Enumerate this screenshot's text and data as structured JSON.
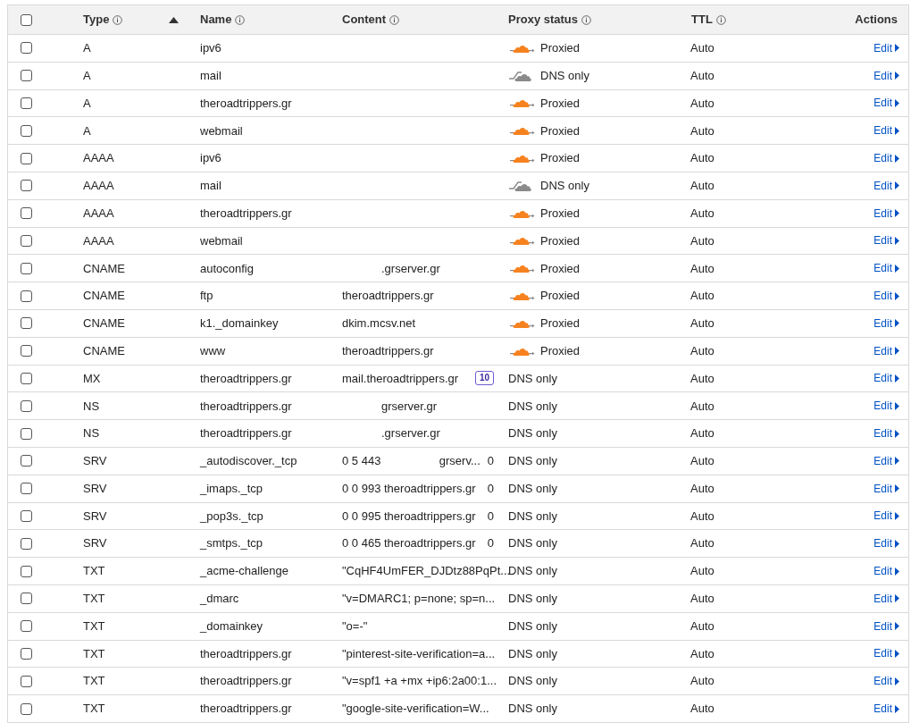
{
  "header": {
    "checkbox": {
      "checked": false
    },
    "columns": [
      {
        "label": "Type",
        "info": true,
        "sorted": true
      },
      {
        "label": "Name",
        "info": true
      },
      {
        "label": "Content",
        "info": true
      },
      {
        "label": "Proxy status",
        "info": true
      },
      {
        "label": "TTL",
        "info": true
      },
      {
        "label": "Actions",
        "info": false
      }
    ]
  },
  "rows": [
    {
      "checked": false,
      "type": "A",
      "name": "ipv6",
      "proxy": {
        "kind": "proxied",
        "label": "Proxied"
      },
      "ttl": "Auto",
      "action": "Edit"
    },
    {
      "checked": false,
      "type": "A",
      "name": "mail",
      "proxy": {
        "kind": "dns_only",
        "label": "DNS only"
      },
      "ttl": "Auto",
      "action": "Edit"
    },
    {
      "checked": false,
      "type": "A",
      "name": "theroadtrippers.gr",
      "proxy": {
        "kind": "proxied",
        "label": "Proxied"
      },
      "ttl": "Auto",
      "action": "Edit"
    },
    {
      "checked": false,
      "type": "A",
      "name": "webmail",
      "proxy": {
        "kind": "proxied",
        "label": "Proxied"
      },
      "ttl": "Auto",
      "action": "Edit"
    },
    {
      "checked": false,
      "type": "AAAA",
      "name": "ipv6",
      "proxy": {
        "kind": "proxied",
        "label": "Proxied"
      },
      "ttl": "Auto",
      "action": "Edit"
    },
    {
      "checked": false,
      "type": "AAAA",
      "name": "mail",
      "proxy": {
        "kind": "dns_only",
        "label": "DNS only"
      },
      "ttl": "Auto",
      "action": "Edit"
    },
    {
      "checked": false,
      "type": "AAAA",
      "name": "theroadtrippers.gr",
      "proxy": {
        "kind": "proxied",
        "label": "Proxied"
      },
      "ttl": "Auto",
      "action": "Edit"
    },
    {
      "checked": false,
      "type": "AAAA",
      "name": "webmail",
      "proxy": {
        "kind": "proxied",
        "label": "Proxied"
      },
      "ttl": "Auto",
      "action": "Edit"
    },
    {
      "checked": false,
      "type": "CNAME",
      "name": "autoconfig",
      "content": {
        "redacted": true,
        "text": ".grserver.gr"
      },
      "proxy": {
        "kind": "proxied",
        "label": "Proxied"
      },
      "ttl": "Auto",
      "action": "Edit"
    },
    {
      "checked": false,
      "type": "CNAME",
      "name": "ftp",
      "content": {
        "text": "theroadtrippers.gr"
      },
      "proxy": {
        "kind": "proxied",
        "label": "Proxied"
      },
      "ttl": "Auto",
      "action": "Edit"
    },
    {
      "checked": false,
      "type": "CNAME",
      "name": "k1._domainkey",
      "content": {
        "text": "dkim.mcsv.net"
      },
      "proxy": {
        "kind": "proxied",
        "label": "Proxied"
      },
      "ttl": "Auto",
      "action": "Edit"
    },
    {
      "checked": false,
      "type": "CNAME",
      "name": "www",
      "content": {
        "text": "theroadtrippers.gr"
      },
      "proxy": {
        "kind": "proxied",
        "label": "Proxied"
      },
      "ttl": "Auto",
      "action": "Edit"
    },
    {
      "checked": false,
      "type": "MX",
      "name": "theroadtrippers.gr",
      "content": {
        "text": "mail.theroadtrippers.gr",
        "badge": "10"
      },
      "proxy": {
        "kind": "none",
        "label": "DNS only"
      },
      "ttl": "Auto",
      "action": "Edit"
    },
    {
      "checked": false,
      "type": "NS",
      "name": "theroadtrippers.gr",
      "content": {
        "redacted": true,
        "text": "grserver.gr"
      },
      "proxy": {
        "kind": "none",
        "label": "DNS only"
      },
      "ttl": "Auto",
      "action": "Edit"
    },
    {
      "checked": false,
      "type": "NS",
      "name": "theroadtrippers.gr",
      "content": {
        "redacted": true,
        "text": ".grserver.gr"
      },
      "proxy": {
        "kind": "none",
        "label": "DNS only"
      },
      "ttl": "Auto",
      "action": "Edit"
    },
    {
      "checked": false,
      "type": "SRV",
      "name": "_autodiscover._tcp",
      "content": {
        "text": "0 5 443",
        "text_2": "grserv...",
        "trailing": "0"
      },
      "proxy": {
        "kind": "none",
        "label": "DNS only"
      },
      "ttl": "Auto",
      "action": "Edit"
    },
    {
      "checked": false,
      "type": "SRV",
      "name": "_imaps._tcp",
      "content": {
        "text": "0 0 993 theroadtrippers.gr",
        "trailing": "0"
      },
      "proxy": {
        "kind": "none",
        "label": "DNS only"
      },
      "ttl": "Auto",
      "action": "Edit"
    },
    {
      "checked": false,
      "type": "SRV",
      "name": "_pop3s._tcp",
      "content": {
        "text": "0 0 995 theroadtrippers.gr",
        "trailing": "0"
      },
      "proxy": {
        "kind": "none",
        "label": "DNS only"
      },
      "ttl": "Auto",
      "action": "Edit"
    },
    {
      "checked": false,
      "type": "SRV",
      "name": "_smtps._tcp",
      "content": {
        "text": "0 0 465 theroadtrippers.gr",
        "trailing": "0"
      },
      "proxy": {
        "kind": "none",
        "label": "DNS only"
      },
      "ttl": "Auto",
      "action": "Edit"
    },
    {
      "checked": false,
      "type": "TXT",
      "name": "_acme-challenge",
      "content": {
        "text": "\"CqHF4UmFER_DJDtz88PqPt..."
      },
      "proxy": {
        "kind": "none",
        "label": "DNS only"
      },
      "ttl": "Auto",
      "action": "Edit"
    },
    {
      "checked": false,
      "type": "TXT",
      "name": "_dmarc",
      "content": {
        "text": "\"v=DMARC1; p=none; sp=n..."
      },
      "proxy": {
        "kind": "none",
        "label": "DNS only"
      },
      "ttl": "Auto",
      "action": "Edit"
    },
    {
      "checked": false,
      "type": "TXT",
      "name": "_domainkey",
      "content": {
        "text": "\"o=-\""
      },
      "proxy": {
        "kind": "none",
        "label": "DNS only"
      },
      "ttl": "Auto",
      "action": "Edit"
    },
    {
      "checked": false,
      "type": "TXT",
      "name": "theroadtrippers.gr",
      "content": {
        "text": "\"pinterest-site-verification=a..."
      },
      "proxy": {
        "kind": "none",
        "label": "DNS only"
      },
      "ttl": "Auto",
      "action": "Edit"
    },
    {
      "checked": false,
      "type": "TXT",
      "name": "theroadtrippers.gr",
      "content": {
        "text": "\"v=spf1 +a +mx +ip6:2a00:1..."
      },
      "proxy": {
        "kind": "none",
        "label": "DNS only"
      },
      "ttl": "Auto",
      "action": "Edit"
    },
    {
      "checked": false,
      "type": "TXT",
      "name": "theroadtrippers.gr",
      "content": {
        "text": "\"google-site-verification=W..."
      },
      "proxy": {
        "kind": "none",
        "label": "DNS only"
      },
      "ttl": "Auto",
      "action": "Edit"
    }
  ]
}
